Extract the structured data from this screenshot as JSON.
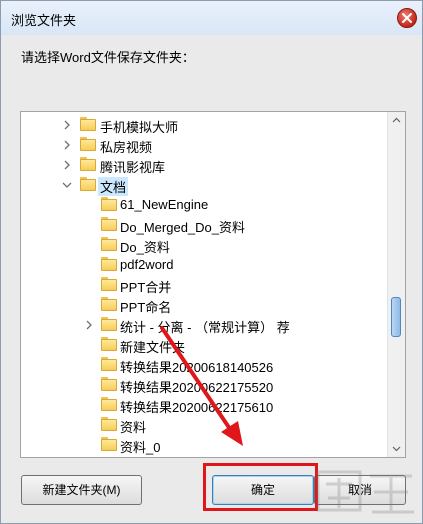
{
  "dialog": {
    "title": "浏览文件夹",
    "instruction": "请选择Word文件保存文件夹："
  },
  "tree": {
    "items": [
      {
        "label": "手机模拟大师",
        "level": 0,
        "expander": "collapsed"
      },
      {
        "label": "私房视频",
        "level": 0,
        "expander": "collapsed"
      },
      {
        "label": "腾讯影视库",
        "level": 0,
        "expander": "collapsed"
      },
      {
        "label": "文档",
        "level": 0,
        "expander": "expanded",
        "selected": true
      },
      {
        "label": "61_NewEngine",
        "level": 1,
        "expander": "none"
      },
      {
        "label": "Do_Merged_Do_资料",
        "level": 1,
        "expander": "none"
      },
      {
        "label": "Do_资料",
        "level": 1,
        "expander": "none"
      },
      {
        "label": "pdf2word",
        "level": 1,
        "expander": "none"
      },
      {
        "label": "PPT合并",
        "level": 1,
        "expander": "none"
      },
      {
        "label": "PPT命名",
        "level": 1,
        "expander": "none"
      },
      {
        "label": "统计 - 分离 - （常规计算） 荐",
        "level": 1,
        "expander": "collapsed"
      },
      {
        "label": "新建文件夹",
        "level": 1,
        "expander": "none"
      },
      {
        "label": "转换结果20200618140526",
        "level": 1,
        "expander": "none"
      },
      {
        "label": "转换结果20200622175520",
        "level": 1,
        "expander": "none"
      },
      {
        "label": "转换结果20200622175610",
        "level": 1,
        "expander": "none"
      },
      {
        "label": "资料",
        "level": 1,
        "expander": "none"
      },
      {
        "label": "资料_0",
        "level": 1,
        "expander": "none"
      }
    ],
    "scroll_position": 0.62
  },
  "buttons": {
    "new_folder": "新建文件夹(M)",
    "ok": "确定",
    "cancel": "取消"
  },
  "colors": {
    "annotation": "#e0171a",
    "selection": "#cce8ff"
  }
}
